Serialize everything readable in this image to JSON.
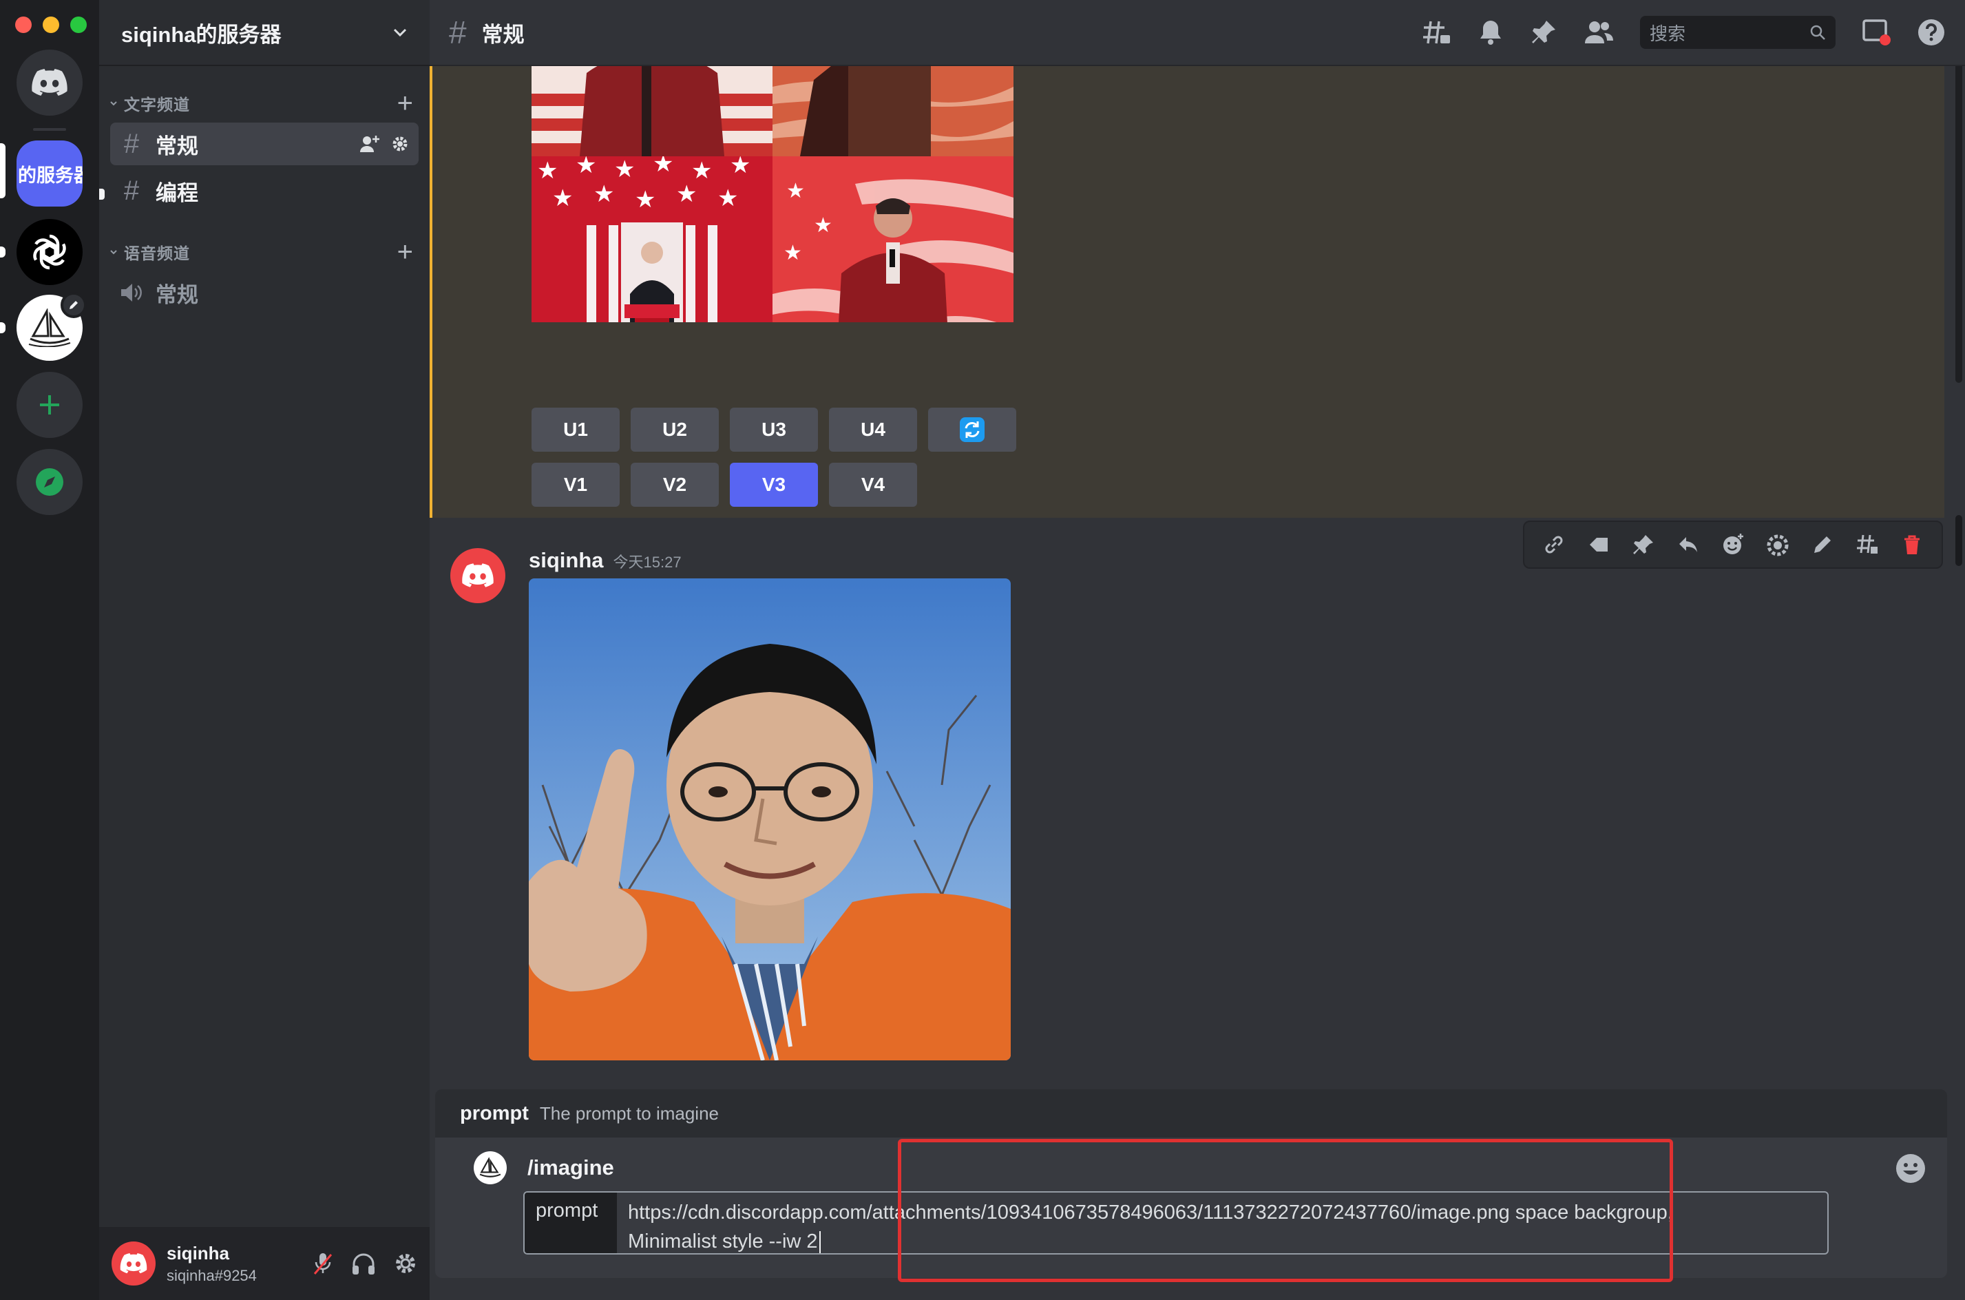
{
  "server": {
    "name": "siqinha的服务器",
    "rail_active_label": "的服务器"
  },
  "categories": {
    "text": "文字频道",
    "voice": "语音频道"
  },
  "channels": [
    {
      "label": "常规",
      "type": "text",
      "active": true
    },
    {
      "label": "编程",
      "type": "text",
      "active": false
    },
    {
      "label": "常规",
      "type": "voice",
      "active": false
    }
  ],
  "topbar": {
    "channel": "常规",
    "search_placeholder": "搜索"
  },
  "buttons_upscale": [
    "U1",
    "U2",
    "U3",
    "U4"
  ],
  "buttons_variation": [
    "V1",
    "V2",
    "V3",
    "V4"
  ],
  "active_button": "V3",
  "message": {
    "author": "siqinha",
    "timestamp": "今天15:27"
  },
  "autocomplete": {
    "option": "prompt",
    "description": "The prompt to imagine"
  },
  "composer": {
    "command": "/imagine",
    "option_label": "prompt",
    "value_line1": "https://cdn.discordapp.com/attachments/1093410673578496063/1113732272072437760/image.png  space backgroup,",
    "value_line2": "Minimalist style --iw 2"
  },
  "user": {
    "name": "siqinha",
    "tag": "siqinha#9254"
  },
  "colors": {
    "blurple": "#5865f2",
    "highlight": "#f0b232",
    "danger": "#e03131",
    "green": "#23a55a"
  }
}
